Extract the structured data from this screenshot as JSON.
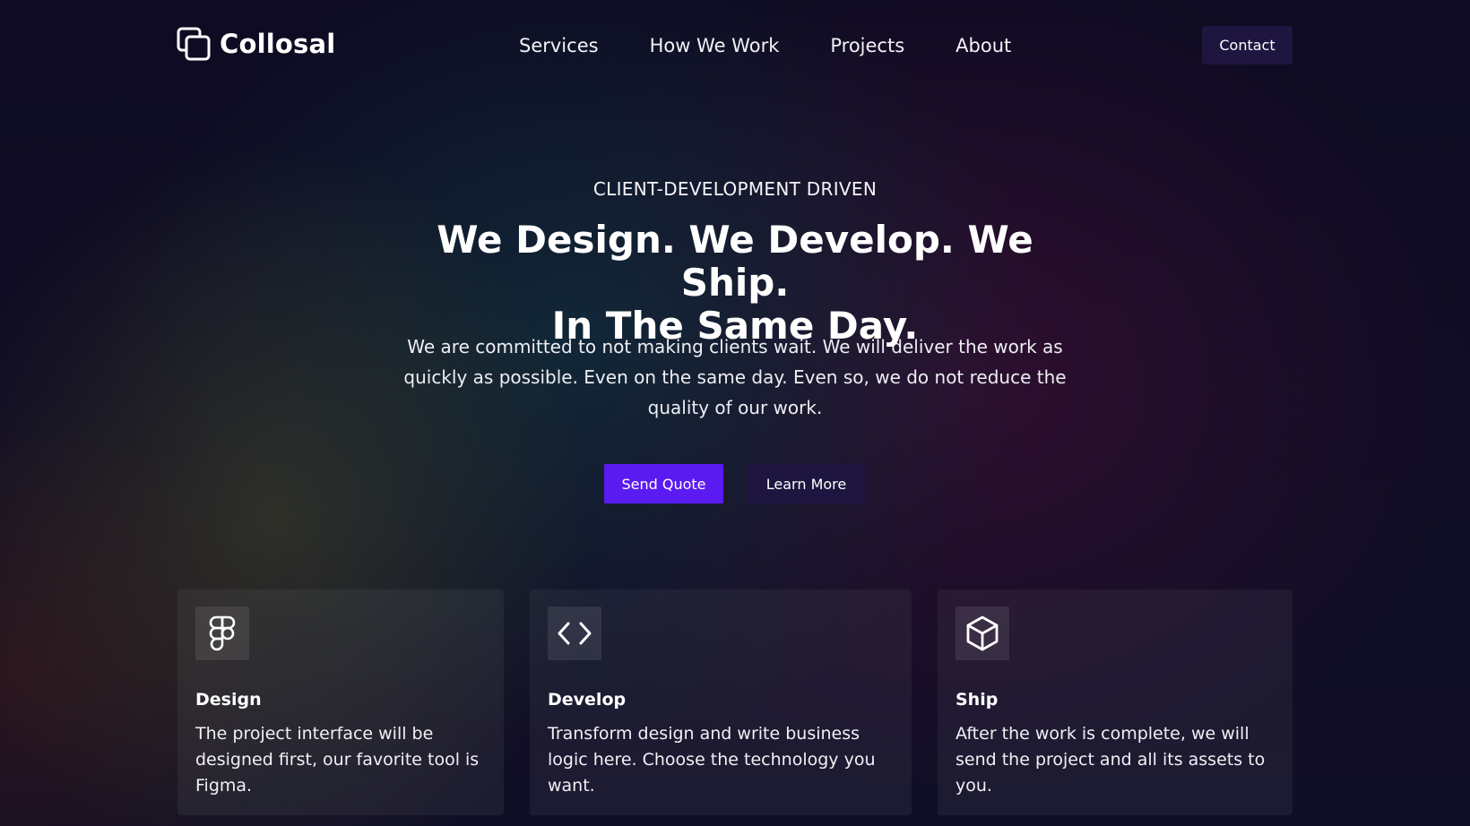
{
  "brand": {
    "name": "Collosal",
    "logo_icon": "stacked-squares-icon"
  },
  "nav": {
    "items": [
      "Services",
      "How We Work",
      "Projects",
      "About"
    ],
    "contact_label": "Contact"
  },
  "hero": {
    "eyebrow": "CLIENT-DEVELOPMENT DRIVEN",
    "title_line1": "We Design. We Develop. We Ship.",
    "title_line2": "In The Same Day.",
    "subtitle": "We are committed to not making clients wait. We will deliver the work as quickly as possible. Even on the same day. Even so, we do not reduce the quality of our work.",
    "primary_button": "Send Quote",
    "secondary_button": "Learn More"
  },
  "features": [
    {
      "icon": "figma-icon",
      "title": "Design",
      "text": "The project interface will be designed first, our favorite tool is Figma."
    },
    {
      "icon": "code-icon",
      "title": "Develop",
      "text": "Transform design and write business logic here. Choose the technology you want."
    },
    {
      "icon": "box-icon",
      "title": "Ship",
      "text": "After the work is complete, we will send the project and all its assets to you."
    }
  ],
  "colors": {
    "accent": "#5a1bf0",
    "secondary_button": "#1e1540",
    "background": "#0f0b22"
  }
}
